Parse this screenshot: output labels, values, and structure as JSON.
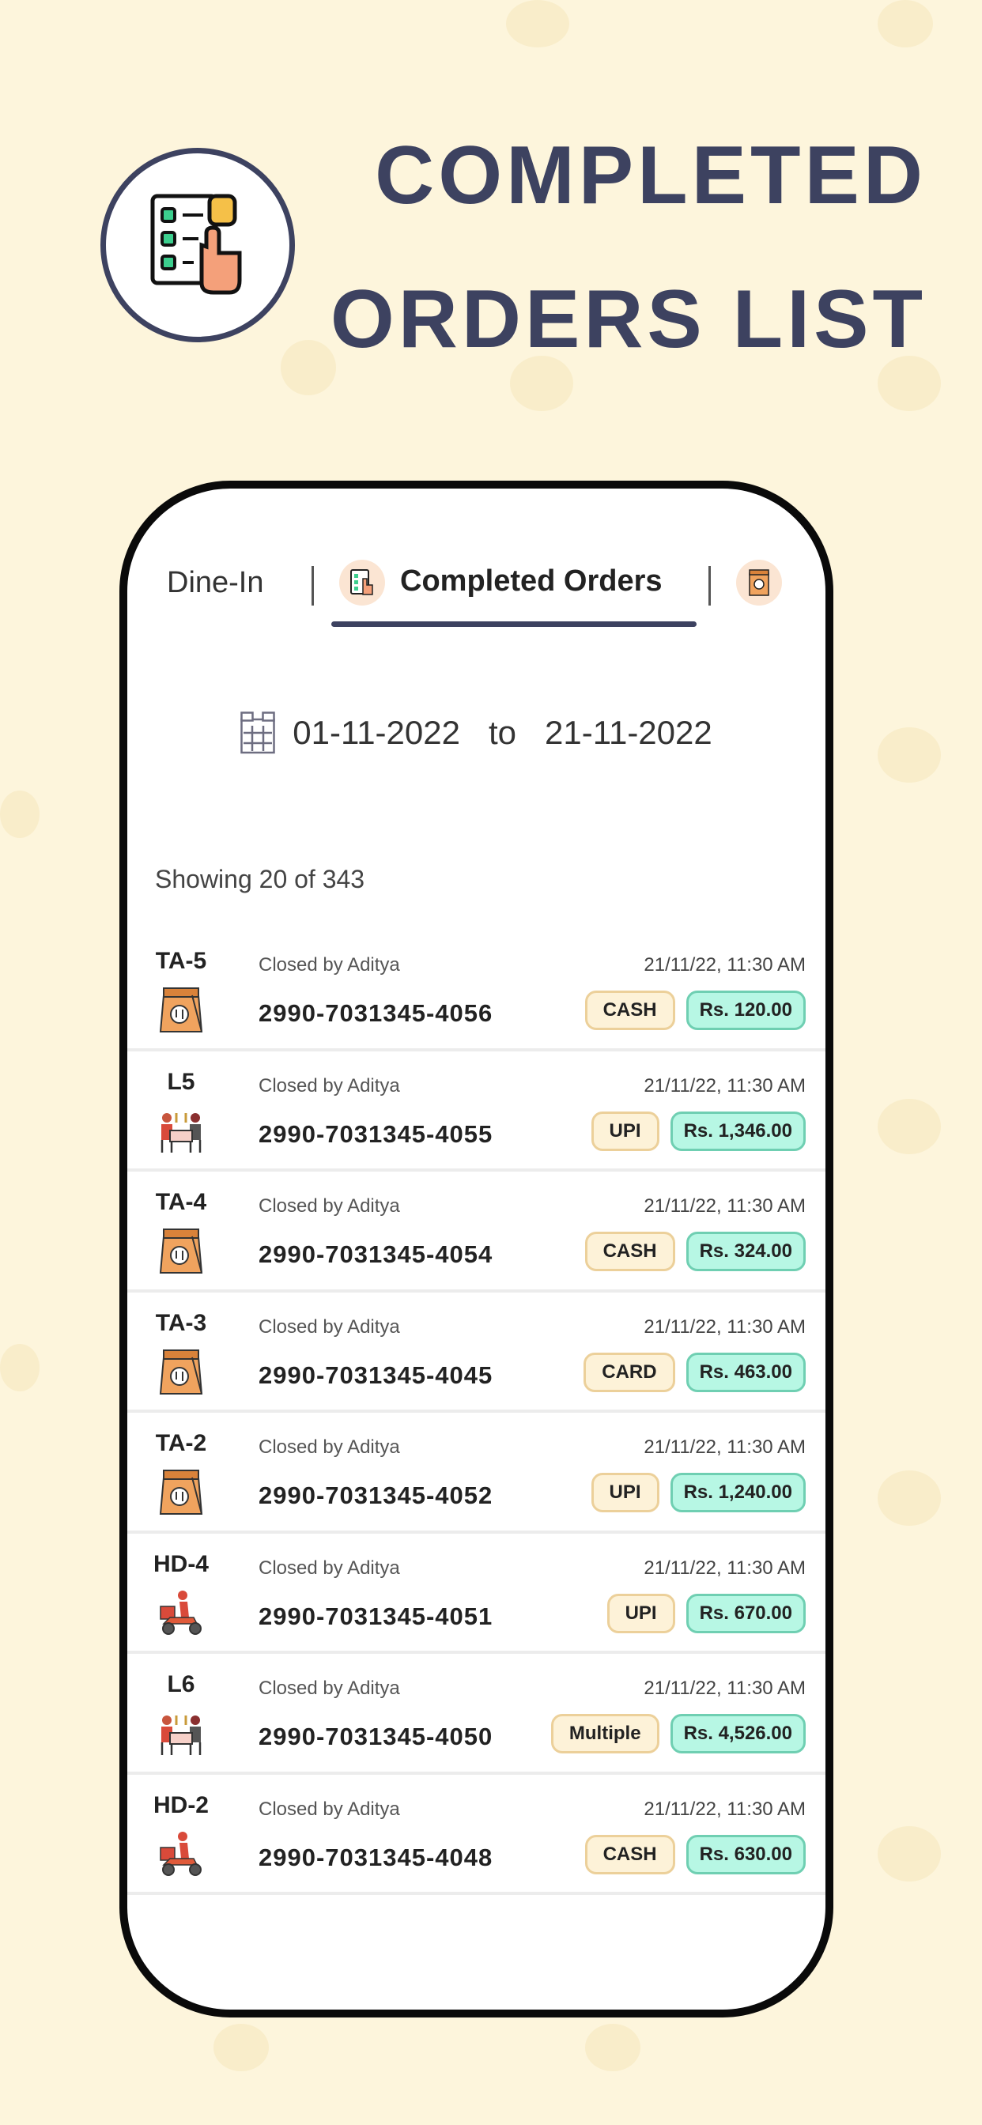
{
  "header": {
    "title_line1": "COMPLETED",
    "title_line2": "ORDERS LIST",
    "logo_icon": "order-list-hand-icon"
  },
  "colors": {
    "background": "#fdf5dc",
    "accent": "#3d4260",
    "payment_pill": "#fdf2d8",
    "amount_pill": "#b7f7e4",
    "takeaway": "#f0a35e"
  },
  "tabs": [
    {
      "label": "Dine-In",
      "active": false
    },
    {
      "label": "Completed Orders",
      "active": true,
      "icon": "order-list-icon"
    },
    {
      "label": "",
      "icon": "takeaway-bag-icon"
    }
  ],
  "date_range": {
    "from": "01-11-2022",
    "separator": "to",
    "to": "21-11-2022"
  },
  "showing": "Showing 20 of 343",
  "orders": [
    {
      "label": "TA-5",
      "type": "takeaway",
      "closed_by": "Closed by Aditya",
      "datetime": "21/11/22, 11:30 AM",
      "order_no": "2990-7031345-4056",
      "payment": "CASH",
      "amount": "Rs. 120.00"
    },
    {
      "label": "L5",
      "type": "dine-in",
      "closed_by": "Closed by Aditya",
      "datetime": "21/11/22, 11:30 AM",
      "order_no": "2990-7031345-4055",
      "payment": "UPI",
      "amount": "Rs. 1,346.00"
    },
    {
      "label": "TA-4",
      "type": "takeaway",
      "closed_by": "Closed by Aditya",
      "datetime": "21/11/22, 11:30 AM",
      "order_no": "2990-7031345-4054",
      "payment": "CASH",
      "amount": "Rs. 324.00"
    },
    {
      "label": "TA-3",
      "type": "takeaway",
      "closed_by": "Closed by Aditya",
      "datetime": "21/11/22, 11:30 AM",
      "order_no": "2990-7031345-4045",
      "payment": "CARD",
      "amount": "Rs. 463.00"
    },
    {
      "label": "TA-2",
      "type": "takeaway",
      "closed_by": "Closed by Aditya",
      "datetime": "21/11/22, 11:30 AM",
      "order_no": "2990-7031345-4052",
      "payment": "UPI",
      "amount": "Rs. 1,240.00"
    },
    {
      "label": "HD-4",
      "type": "delivery",
      "closed_by": "Closed by Aditya",
      "datetime": "21/11/22, 11:30 AM",
      "order_no": "2990-7031345-4051",
      "payment": "UPI",
      "amount": "Rs. 670.00"
    },
    {
      "label": "L6",
      "type": "dine-in",
      "closed_by": "Closed by Aditya",
      "datetime": "21/11/22, 11:30 AM",
      "order_no": "2990-7031345-4050",
      "payment": "Multiple",
      "amount": "Rs. 4,526.00"
    },
    {
      "label": "HD-2",
      "type": "delivery",
      "closed_by": "Closed by Aditya",
      "datetime": "21/11/22, 11:30 AM",
      "order_no": "2990-7031345-4048",
      "payment": "CASH",
      "amount": "Rs. 630.00"
    }
  ]
}
